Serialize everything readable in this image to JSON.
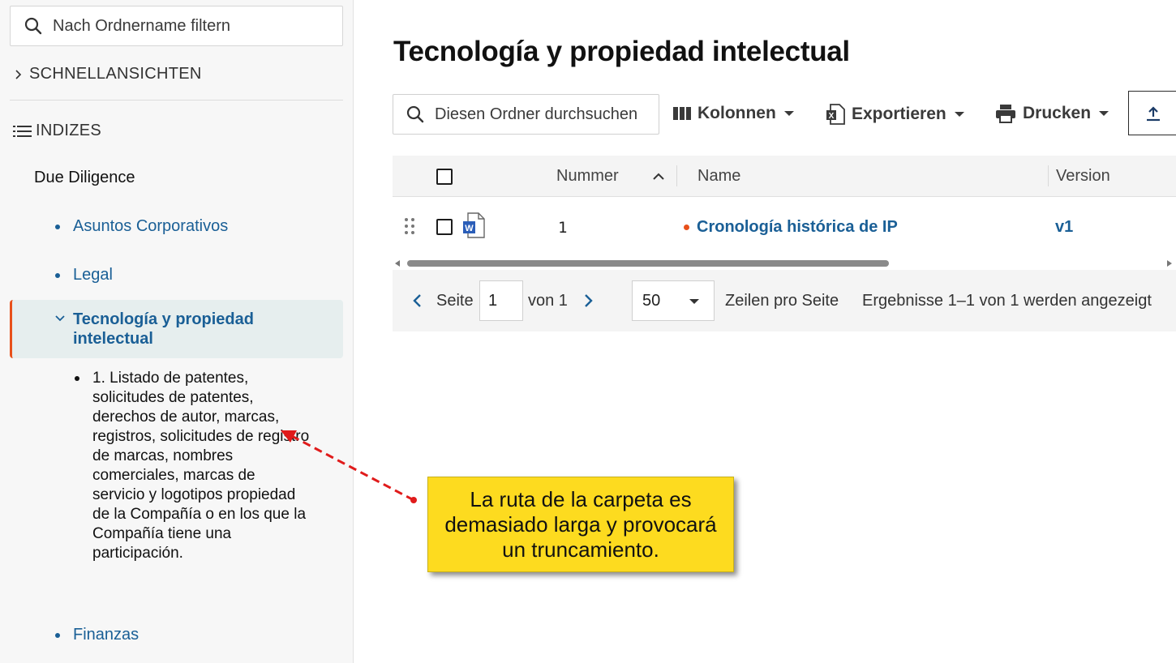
{
  "sidebar": {
    "filter_placeholder": "Nach Ordnername filtern",
    "quick_views_label": "SCHNELLANSICHTEN",
    "indices_label": "INDIZES",
    "root_label": "Due Diligence",
    "items": [
      {
        "label": "Asuntos Corporativos"
      },
      {
        "label": "Legal"
      },
      {
        "label": "Tecnología y propiedad intelectual"
      },
      {
        "label": "Finanzas"
      }
    ],
    "sub_item": "1. Listado de patentes, solicitudes de patentes, derechos de autor, marcas, registros, solicitudes de registro de marcas, nombres comerciales, marcas de servicio y logotipos propiedad de la Compañía o en los que la Compañía tiene una participación."
  },
  "main": {
    "title": "Tecnología y propiedad intelectual",
    "search_placeholder": "Diesen Ordner durchsuchen",
    "toolbar": {
      "columns_label": "Kolonnen",
      "export_label": "Exportieren",
      "print_label": "Drucken"
    },
    "grid": {
      "headers": {
        "number": "Nummer",
        "name": "Name",
        "version": "Version"
      },
      "rows": [
        {
          "number": "1",
          "name": "Cronología histórica de IP",
          "version": "v1"
        }
      ]
    },
    "pager": {
      "page_label": "Seite",
      "page_value": "1",
      "of_label": "von 1",
      "rows_per_page_value": "50",
      "rows_per_page_label": "Zeilen pro Seite",
      "results_text": "Ergebnisse 1–1 von 1 werden angezeigt"
    }
  },
  "callout": {
    "text": "La ruta de la carpeta es demasiado larga y provocará un truncamiento."
  },
  "colors": {
    "link": "#1a5f96",
    "accent": "#e8501a",
    "callout_bg": "#fddb1f",
    "arrow": "#e01b1b"
  }
}
